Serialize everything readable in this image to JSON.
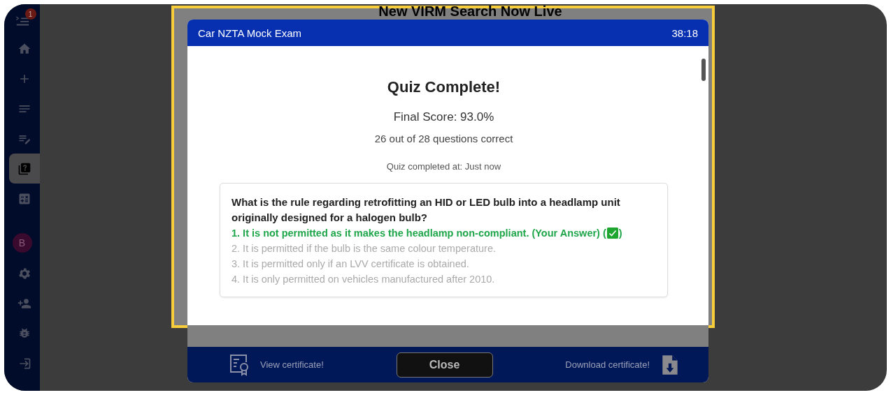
{
  "sidebar": {
    "badge": "1",
    "avatar": "B",
    "items": [
      {
        "kind": "home",
        "selected": false
      },
      {
        "kind": "add",
        "selected": false
      },
      {
        "kind": "list",
        "selected": false
      },
      {
        "kind": "edit",
        "selected": false
      },
      {
        "kind": "quiz",
        "selected": true
      },
      {
        "kind": "calculator",
        "selected": false
      }
    ],
    "bottom_items": [
      {
        "kind": "settings"
      },
      {
        "kind": "add-user"
      },
      {
        "kind": "bug"
      },
      {
        "kind": "logout"
      }
    ]
  },
  "page": {
    "heading": "New VIRM Search Now Live"
  },
  "modal": {
    "title": "Car NZTA Mock Exam",
    "timer": "38:18",
    "result": {
      "title": "Quiz Complete!",
      "score": "Final Score: 93.0%",
      "summary": "26 out of 28 questions correct",
      "completed": "Quiz completed at: Just now"
    },
    "questions": [
      {
        "text": "What is the rule regarding retrofitting an HID or LED bulb into a headlamp unit originally designed for a halogen bulb?",
        "answers": [
          {
            "text": "1. It is not permitted as it makes the headlamp non-compliant. (Your Answer)",
            "selected": true,
            "correct": true,
            "mark_open": "(",
            "mark_close": ")"
          },
          {
            "text": "2. It is permitted if the bulb is the same colour temperature.",
            "selected": false,
            "correct": false
          },
          {
            "text": "3. It is permitted only if an LVV certificate is obtained.",
            "selected": false,
            "correct": false
          },
          {
            "text": "4. It is only permitted on vehicles manufactured after 2010.",
            "selected": false,
            "correct": false
          }
        ]
      }
    ],
    "footer": {
      "view": "View certificate!",
      "close": "Close",
      "download": "Download certificate!"
    }
  }
}
